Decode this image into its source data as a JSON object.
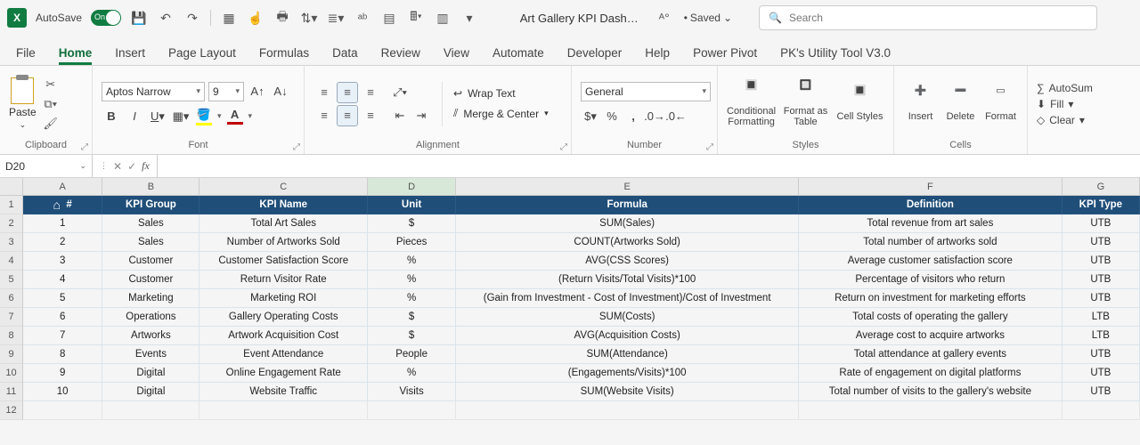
{
  "titlebar": {
    "autosave_label": "AutoSave",
    "autosave_on": "On",
    "doc_title": "Art Gallery KPI Dashb…",
    "saved_label": "Saved",
    "search_placeholder": "Search"
  },
  "tabs": [
    "File",
    "Home",
    "Insert",
    "Page Layout",
    "Formulas",
    "Data",
    "Review",
    "View",
    "Automate",
    "Developer",
    "Help",
    "Power Pivot",
    "PK's Utility Tool V3.0"
  ],
  "active_tab": "Home",
  "ribbon": {
    "clipboard": {
      "label": "Clipboard",
      "paste": "Paste"
    },
    "font": {
      "label": "Font",
      "font_name": "Aptos Narrow",
      "font_size": "9",
      "highlight_color": "#ffff00",
      "font_color": "#c00000"
    },
    "alignment": {
      "label": "Alignment",
      "wrap_text": "Wrap Text",
      "merge_center": "Merge & Center"
    },
    "number": {
      "label": "Number",
      "format": "General"
    },
    "styles": {
      "label": "Styles",
      "conditional": "Conditional Formatting",
      "format_table": "Format as Table",
      "cell_styles": "Cell Styles"
    },
    "cells": {
      "label": "Cells",
      "insert": "Insert",
      "delete": "Delete",
      "format": "Format"
    },
    "editing": {
      "autosum": "AutoSum",
      "fill": "Fill",
      "clear": "Clear"
    }
  },
  "name_box": "D20",
  "columns": [
    "A",
    "B",
    "C",
    "D",
    "E",
    "F",
    "G"
  ],
  "selected_column": "D",
  "selected_cell": "D20",
  "table": {
    "headers": [
      "#",
      "KPI Group",
      "KPI Name",
      "Unit",
      "Formula",
      "Definition",
      "KPI Type"
    ],
    "rows": [
      [
        "1",
        "Sales",
        "Total Art Sales",
        "$",
        "SUM(Sales)",
        "Total revenue from art sales",
        "UTB"
      ],
      [
        "2",
        "Sales",
        "Number of Artworks Sold",
        "Pieces",
        "COUNT(Artworks Sold)",
        "Total number of artworks sold",
        "UTB"
      ],
      [
        "3",
        "Customer",
        "Customer Satisfaction Score",
        "%",
        "AVG(CSS Scores)",
        "Average customer satisfaction score",
        "UTB"
      ],
      [
        "4",
        "Customer",
        "Return Visitor Rate",
        "%",
        "(Return Visits/Total Visits)*100",
        "Percentage of visitors who return",
        "UTB"
      ],
      [
        "5",
        "Marketing",
        "Marketing ROI",
        "%",
        "(Gain from Investment - Cost of Investment)/Cost of Investment",
        "Return on investment for marketing efforts",
        "UTB"
      ],
      [
        "6",
        "Operations",
        "Gallery Operating Costs",
        "$",
        "SUM(Costs)",
        "Total costs of operating the gallery",
        "LTB"
      ],
      [
        "7",
        "Artworks",
        "Artwork Acquisition Cost",
        "$",
        "AVG(Acquisition Costs)",
        "Average cost to acquire artworks",
        "LTB"
      ],
      [
        "8",
        "Events",
        "Event Attendance",
        "People",
        "SUM(Attendance)",
        "Total attendance at gallery events",
        "UTB"
      ],
      [
        "9",
        "Digital",
        "Online Engagement Rate",
        "%",
        "(Engagements/Visits)*100",
        "Rate of engagement on digital platforms",
        "UTB"
      ],
      [
        "10",
        "Digital",
        "Website Traffic",
        "Visits",
        "SUM(Website Visits)",
        "Total number of visits to the gallery's website",
        "UTB"
      ]
    ]
  },
  "row_numbers": [
    "1",
    "2",
    "3",
    "4",
    "5",
    "6",
    "7",
    "8",
    "9",
    "10",
    "11",
    "12"
  ]
}
